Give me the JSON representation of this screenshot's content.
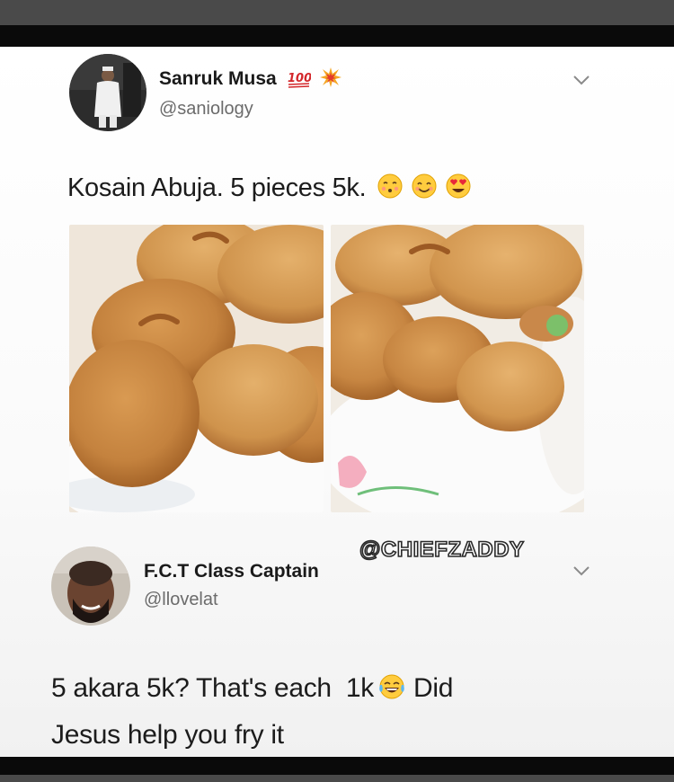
{
  "tweet": {
    "author": {
      "name": "Sanruk Musa",
      "handle": "@saniology",
      "badges": [
        "hundred-points-emoji",
        "collision-emoji"
      ]
    },
    "text": "Kosain Abuja. 5 pieces 5k.",
    "text_emojis": [
      "kissing-face-emoji",
      "smiling-face-emoji",
      "heart-eyes-emoji"
    ],
    "images": [
      "akara-photo-left",
      "akara-photo-right"
    ]
  },
  "reply": {
    "author": {
      "name": "F.C.T Class Captain",
      "handle": "@llovelat"
    },
    "text_before_emoji": "5 akara 5k? That's each  1k",
    "text_after_emoji": " Did",
    "text_line2": "Jesus help you fry it",
    "emoji": "tears-of-joy-emoji"
  },
  "watermark": "@CHIEFZADDY",
  "colors": {
    "card_background": "#ffffff",
    "frame_dark": "#0a0a0a",
    "frame_grey": "#4a4a4a",
    "text_primary": "#1c1c1c",
    "text_secondary": "#6b6b6b"
  }
}
